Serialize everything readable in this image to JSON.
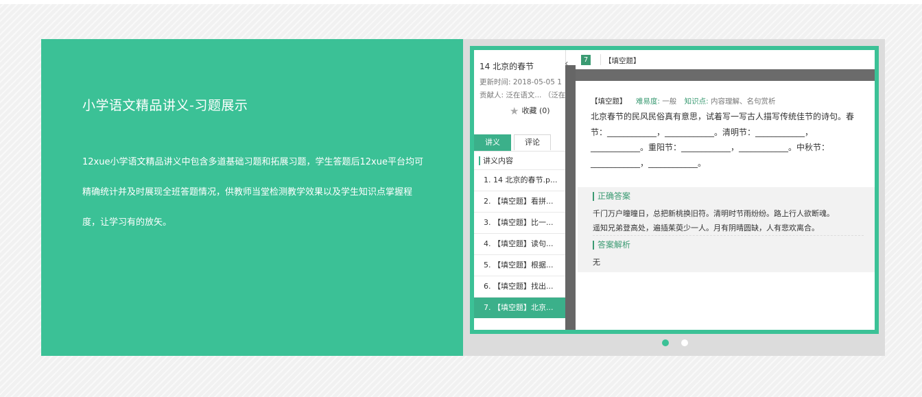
{
  "promo": {
    "title": "小学语文精品讲义-习题展示",
    "description": "12xue小学语文精品讲义中包含多道基础习题和拓展习题，学生答题后12xue平台均可精确统计并及时展现全班答题情况，供教师当堂检测教学效果以及学生知识点掌握程度，让学习有的放矢。"
  },
  "sidebar": {
    "lesson_title": "14 北京的春节",
    "updated": "更新时间:  2018-05-05 1",
    "contributor": "贡献人:  泛在语文... （泛在",
    "collect_label": "收藏 (0)",
    "tabs": [
      {
        "label": "讲义"
      },
      {
        "label": "评论"
      }
    ],
    "section_label": "讲义内容",
    "items": [
      {
        "label": "1. 14 北京的春节.p..."
      },
      {
        "label": "2. 【填空题】看拼..."
      },
      {
        "label": "3. 【填空题】比一..."
      },
      {
        "label": "4. 【填空题】读句..."
      },
      {
        "label": "5. 【填空题】根据..."
      },
      {
        "label": "6. 【填空题】找出..."
      },
      {
        "label": "7. 【填空题】北京..."
      }
    ]
  },
  "content": {
    "number": "7",
    "header_type": "【填空题】",
    "question_type": "【填空题】",
    "difficulty_label": "难易度:",
    "difficulty_value": "一般",
    "knowledge_label": "知识点:",
    "knowledge_value": "内容理解、名句赏析",
    "question": "北京春节的民风民俗真有意思，试着写一写古人描写传统佳节的诗句。春 节：____________，____________。清明节：____________，____________。重阳节：____________，____________。中秋节：____________，____________。",
    "correct_answer_label": "正确答案",
    "answer_line1": "千门万户曈曈日，总把新桃换旧符。清明时节雨纷纷。路上行人欲断魂。",
    "answer_line2": "遥知兄弟登高处，遍插茱萸少一人。月有阴晴圆缺，人有悲欢离合。",
    "analysis_label": "答案解析",
    "analysis_value": "无"
  },
  "carousel": {
    "slide_count": 2,
    "active_index": 0
  },
  "colors": {
    "brand_green": "#3bc196",
    "tab_green": "#3bb08a",
    "text_green": "#3a9a72"
  },
  "icons": {
    "collapse": "chevron-left-icon",
    "collect": "star-icon"
  }
}
